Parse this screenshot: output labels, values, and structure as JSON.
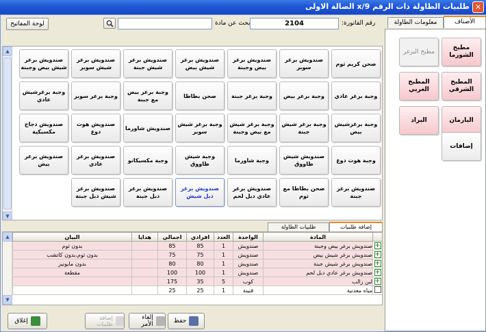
{
  "window": {
    "title": "طلبيات الطاولة ذات الرقم 9/x الصالة الاولى",
    "close_glyph": "✕"
  },
  "toolbar": {
    "keyboard_label": "لوحة المفاتيح",
    "search_label": "بحث عن مادة",
    "search_value": "",
    "search_icon": "magnifier-icon",
    "invoice_label": "رقم الفاتورة:",
    "invoice_number": "2104"
  },
  "right_tabs": [
    "الأصناف",
    "معلومات الطاولة"
  ],
  "categories": [
    {
      "label": "مطبخ الشورما",
      "style": "pink"
    },
    {
      "label": "مطبخ البرغر",
      "style": "grey"
    },
    {
      "label": "المطبخ الشرقي",
      "style": "pink"
    },
    {
      "label": "المطبخ الغربي",
      "style": "pink"
    },
    {
      "label": "البارمان",
      "style": "pink"
    },
    {
      "label": "البراد",
      "style": "pink"
    },
    {
      "label": "إضافات",
      "style": "plain"
    }
  ],
  "products": [
    "صحن كريم ثوم",
    "صندويش برغر سوبر",
    "صندويش برغر بيض وجبنة",
    "صندويش برغر شيش بيض",
    "صندويش برغر شيش جبنة",
    "صندويش برغر شيش سوبر",
    "صندويش برغر شيش بيض وجبنة",
    "وجبة برغر عادي",
    "وجبة برغر بيض",
    "وجبة برغر جبنة",
    "صحن بطاطا",
    "وجبة برغر بيض مع جبنة",
    "وجبة برغر سوبر",
    "وجبة برغرشيش عادي",
    "وجبة برغرشيش بيض",
    "وجبة برغر شيش جبنة",
    "وجبة برغر شيش مع بيض وجبنة",
    "وجبة برغر شيش سوبر",
    "صندويش شاورما",
    "صندويش هوت دوغ",
    "صندويش دجاج مكسيكية",
    "وجبة هوت دوغ",
    "صندويش شيش طاووق",
    "وجبة شاورما",
    "وجبة شيش طاووق",
    "وجبة مكسيكانو",
    "صندويش برغر عادي",
    "صندويش برغر بيض",
    "صندويش برغر جبنة",
    "صحن بطاطا مع ثوم",
    "صندويش برغر عادي دبل لحم",
    "صندويش برغر دبل شيش",
    "صندويش برغر دبل جبنة",
    "صندويش برغر شيش دبل جبنة"
  ],
  "selected_product_index": 31,
  "order_tabs": [
    "إضافة طلبيات",
    "طلبيات الطاولة"
  ],
  "table": {
    "headers": [
      "المادة",
      "الواحدة",
      "العدد",
      "افرادي",
      "اجمالي",
      "هدايا",
      "البيان"
    ],
    "rows": [
      {
        "item": "صندويش برغر بيض وجبنة",
        "unit": "صندويش",
        "qty": "1",
        "price": "85",
        "total": "85",
        "gift": "",
        "note": "بدون ثوم",
        "style": "pink",
        "mark": "plus"
      },
      {
        "item": "صندويش برغر شيش بيض",
        "unit": "صندويش",
        "qty": "1",
        "price": "75",
        "total": "75",
        "gift": "",
        "note": "بدون ثوم،بدون كاتشب",
        "style": "pink",
        "mark": "plus"
      },
      {
        "item": "صندويش برغر شيش جبنة",
        "unit": "صندويش",
        "qty": "1",
        "price": "80",
        "total": "80",
        "gift": "",
        "note": "بدون مايونيز",
        "style": "pink",
        "mark": "plus"
      },
      {
        "item": "صندويش برغر عادي دبل لحم",
        "unit": "صندويش",
        "qty": "1",
        "price": "100",
        "total": "100",
        "gift": "",
        "note": "مقطعة",
        "style": "pink",
        "mark": "plus"
      },
      {
        "item": "لبن زالب",
        "unit": "كوب",
        "qty": "5",
        "price": "35",
        "total": "175",
        "gift": "",
        "note": "",
        "style": "pink",
        "mark": "plus"
      },
      {
        "item": "مياه معدنية",
        "unit": "قنينة",
        "qty": "1",
        "price": "25",
        "total": "25",
        "gift": "",
        "note": "",
        "style": "white",
        "mark": "box"
      }
    ]
  },
  "buttons": {
    "close": "إغلاق",
    "add_orders": "إضافة طلبيات",
    "cancel": "إلغاء الأمر",
    "save": "حفظ"
  }
}
